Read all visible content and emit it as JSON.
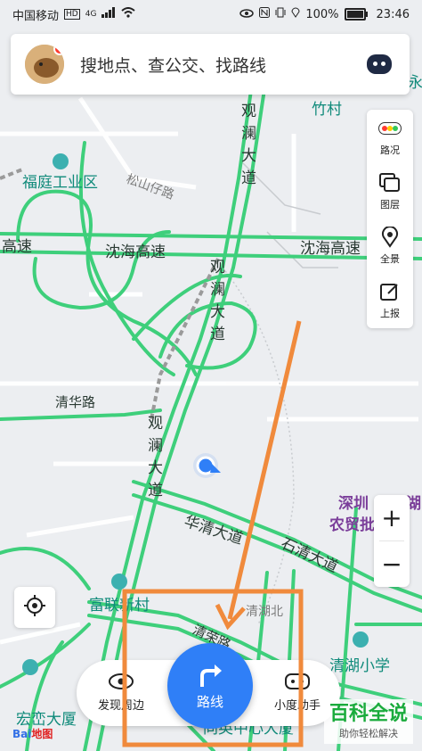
{
  "status_bar": {
    "carrier": "中国移动",
    "net1": "HD",
    "net2": "4G",
    "battery": "100%",
    "time": "23:46"
  },
  "search": {
    "placeholder": "搜地点、查公交、找路线"
  },
  "side_panel": {
    "items": [
      {
        "label": "路况",
        "icon": "traffic-light-icon"
      },
      {
        "label": "图层",
        "icon": "layers-icon"
      },
      {
        "label": "全景",
        "icon": "panorama-icon"
      },
      {
        "label": "上报",
        "icon": "report-icon"
      }
    ]
  },
  "zoom": {
    "in": "+",
    "out": "−"
  },
  "bottom_bar": {
    "discover": "发现周边",
    "route": "路线",
    "assistant": "小度助手"
  },
  "map_labels": {
    "fuding_industry": "福庭工业区",
    "songshan_road": "松山仔路",
    "highway_left": "高速",
    "shenhai_1": "沈海高速",
    "shenhai_2": "沈海高速",
    "guanlan_top": "观澜大道",
    "guanlan_mid": "观澜大道",
    "guanlan_low": "观澜大道",
    "qinghua_road": "清华路",
    "huaqing_avenue": "华清大道",
    "shiqing_avenue": "石清大道",
    "fulian_village": "富联新村",
    "qinghu_north": "清湖北",
    "qingrong_road": "清荣路",
    "qinghu_primary": "清湖小学",
    "hongluan_building": "宏峦大厦",
    "center_building": "同英中心大厦",
    "zhucun": "竹村",
    "shenzhen_agri": "深圳",
    "agri_market": "农贸批",
    "right_edge_1": "永",
    "right_edge_2": "湖"
  },
  "watermark": {
    "title": "百科全说",
    "subtitle": "助你轻松解决"
  },
  "baidu": {
    "brand": "Bai",
    "map": "地图"
  },
  "colors": {
    "road_green": "#3ecf7b",
    "accent_blue": "#2f7ff7",
    "annotation_orange": "#f08a3c",
    "map_bg": "#eceef1"
  }
}
